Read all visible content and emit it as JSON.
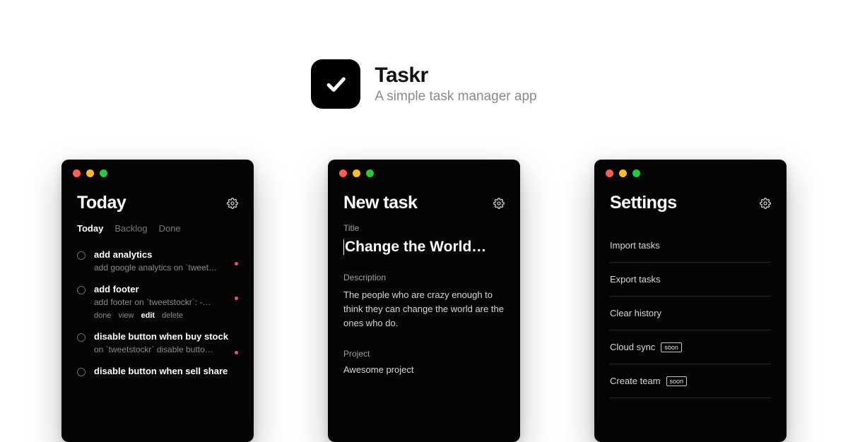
{
  "hero": {
    "title": "Taskr",
    "subtitle": "A simple task manager app"
  },
  "screen_today": {
    "title": "Today",
    "tabs": [
      "Today",
      "Backlog",
      "Done"
    ],
    "active_tab": 0,
    "tasks": [
      {
        "title": "add analytics",
        "desc": "add google analytics on `tweet…",
        "actions": null,
        "dot": true
      },
      {
        "title": "add footer",
        "desc": "add footer on `tweetstockr`: -…",
        "actions": [
          "done",
          "view",
          "edit",
          "delete"
        ],
        "action_active": "edit",
        "dot": true
      },
      {
        "title": "disable button when buy stock",
        "desc": "on `tweetstockr` disable butto…",
        "actions": null,
        "dot": true
      },
      {
        "title": "disable button when sell share",
        "desc": "",
        "actions": null,
        "dot": false
      }
    ]
  },
  "screen_new": {
    "title": "New task",
    "labels": {
      "title": "Title",
      "description": "Description",
      "project": "Project"
    },
    "title_value": "Change the World…",
    "description_value": "The people who are crazy enough to think they can change the world are the ones who do.",
    "project_value": "Awesome project"
  },
  "screen_settings": {
    "title": "Settings",
    "items": [
      {
        "label": "Import tasks",
        "badge": null
      },
      {
        "label": "Export tasks",
        "badge": null
      },
      {
        "label": "Clear history",
        "badge": null
      },
      {
        "label": "Cloud sync",
        "badge": "soon"
      },
      {
        "label": "Create team",
        "badge": "soon"
      }
    ]
  }
}
